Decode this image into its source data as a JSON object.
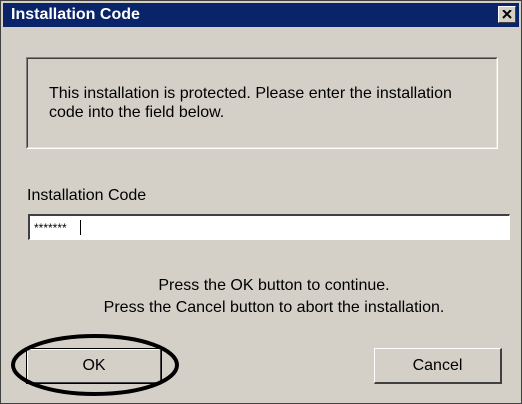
{
  "window": {
    "title": "Installation Code",
    "close_icon": "close-icon"
  },
  "info": {
    "message": "This installation is protected. Please enter the installation code into the field below."
  },
  "form": {
    "label": "Installation Code",
    "value": "*******"
  },
  "instructions": {
    "line1": "Press the OK button to continue.",
    "line2": "Press the Cancel button to abort the installation."
  },
  "buttons": {
    "ok": "OK",
    "cancel": "Cancel"
  },
  "colors": {
    "titlebar": "#0a246a",
    "dialog_face": "#d4d0c8",
    "annotation": "#000000"
  }
}
